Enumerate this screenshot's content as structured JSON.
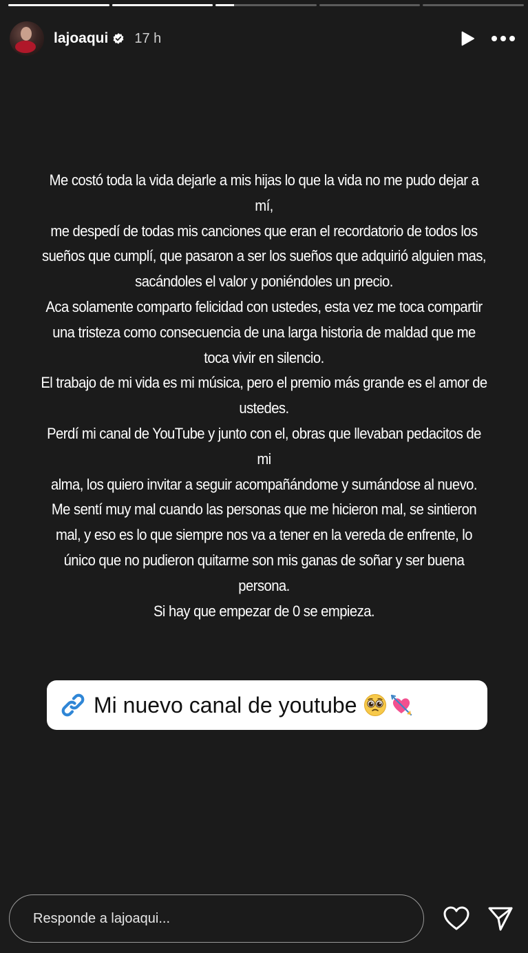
{
  "story": {
    "progress": [
      1,
      1,
      0.18,
      0,
      0
    ],
    "author": {
      "username": "lajoaqui",
      "verified": true,
      "time": "17 h"
    },
    "icons": {
      "play": "play-icon",
      "more": "more-horizontal-icon",
      "verified": "verified-badge-icon",
      "link": "link-icon",
      "like": "heart-icon",
      "send": "send-icon"
    },
    "text_lines": [
      "Me costó toda la vida dejarle a mis hijas lo que la vida no me pudo dejar a mí,",
      "me despedí de todas mis canciones que eran el recordatorio de todos los",
      "sueños que cumplí, que pasaron a ser los sueños que adquirió alguien mas,",
      "sacándoles el valor y poniéndoles un precio.",
      "Aca solamente comparto felicidad con ustedes, esta vez me toca compartir",
      "una tristeza como consecuencia de una larga historia de maldad que me",
      "toca vivir en silencio.",
      "El trabajo de mi vida es mi música, pero el premio más grande es el amor de",
      "ustedes.",
      "Perdí mi canal de YouTube y junto con el, obras que llevaban pedacitos de mi",
      "alma,  los quiero invitar a seguir acompañándome  y sumándose al nuevo.",
      "Me sentí muy mal cuando las personas que me hicieron mal, se sintieron",
      "mal, y eso es lo que siempre nos va a tener en la vereda de enfrente, lo",
      "único que no pudieron quitarme son mis ganas de soñar y ser buena",
      "persona.",
      "Si hay que empezar de 0 se empieza."
    ],
    "link_sticker": {
      "label": "Mi nuevo canal de youtube",
      "emojis": [
        "pleading-face-emoji",
        "heart-with-arrow-emoji"
      ],
      "accent_color": "#2f86d6"
    },
    "reply": {
      "placeholder": "Responde a lajoaqui..."
    }
  }
}
